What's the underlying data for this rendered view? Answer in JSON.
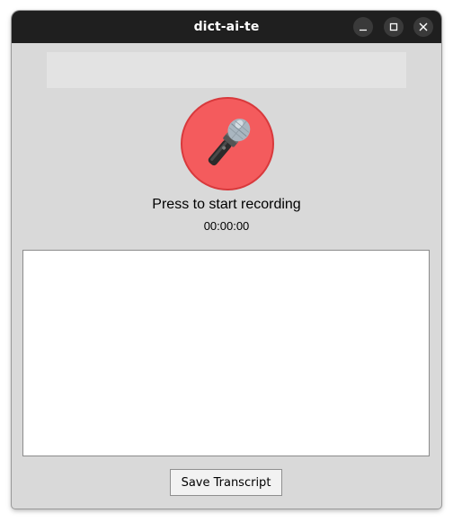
{
  "window": {
    "title": "dict-ai-te",
    "controls": {
      "minimize_icon": "minimize-icon",
      "maximize_icon": "maximize-icon",
      "close_icon": "close-icon"
    }
  },
  "recorder": {
    "status_message": "",
    "mic_icon": "microphone-icon",
    "status_text": "Press to start recording",
    "timer": "00:00:00"
  },
  "transcript": {
    "value": ""
  },
  "actions": {
    "save_label": "Save Transcript"
  },
  "colors": {
    "titlebar": "#1f1f1f",
    "window_bg": "#d9d9d9",
    "record_button": "#f45b5d",
    "record_button_border": "#d8393c"
  }
}
